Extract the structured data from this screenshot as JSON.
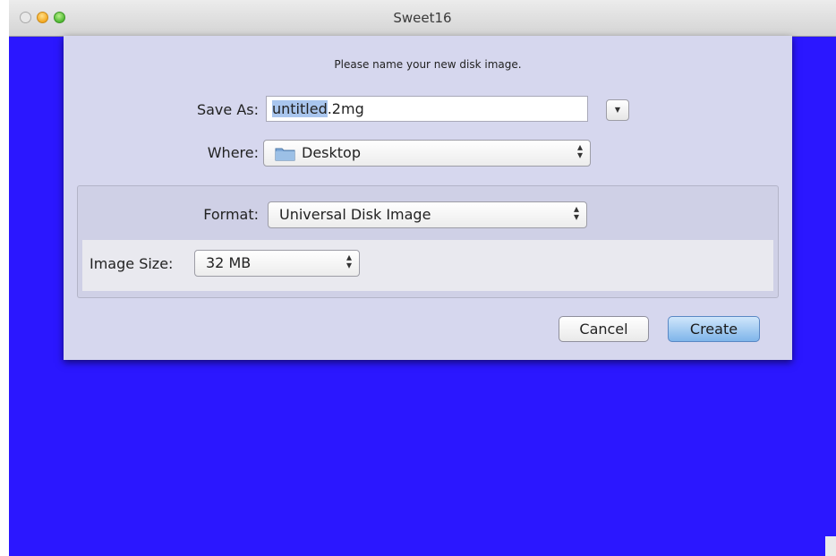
{
  "window": {
    "title": "Sweet16",
    "background_color": "#2b17ff"
  },
  "dialog": {
    "prompt": "Please name your new disk image.",
    "save_as": {
      "label": "Save As:",
      "value_selected": "untitled",
      "value_rest": ".2mg"
    },
    "expand_button_icon": "disclosure-triangle-icon",
    "where": {
      "label": "Where:",
      "value": "Desktop",
      "icon": "folder-icon"
    },
    "format": {
      "label": "Format:",
      "value": "Universal Disk Image"
    },
    "image_size": {
      "label": "Image Size:",
      "value": "32 MB"
    },
    "buttons": {
      "cancel": "Cancel",
      "create": "Create"
    }
  }
}
